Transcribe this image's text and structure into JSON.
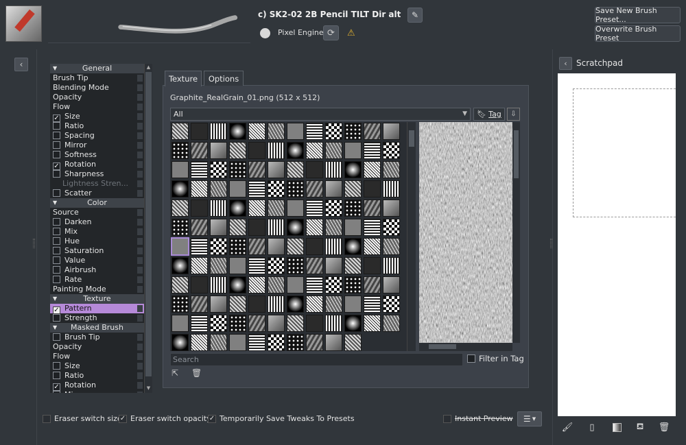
{
  "header": {
    "preset_name": "c) SK2-02 2B Pencil TILT Dir alt",
    "engine_label": "Pixel Engine",
    "save_new_label": "Save New Brush Preset...",
    "overwrite_label": "Overwrite Brush Preset"
  },
  "options_list": [
    {
      "type": "header",
      "label": "General"
    },
    {
      "type": "item",
      "label": "Brush Tip"
    },
    {
      "type": "item",
      "label": "Blending Mode"
    },
    {
      "type": "item",
      "label": "Opacity"
    },
    {
      "type": "item",
      "label": "Flow"
    },
    {
      "type": "check",
      "label": "Size",
      "checked": true
    },
    {
      "type": "check",
      "label": "Ratio",
      "checked": false
    },
    {
      "type": "check",
      "label": "Spacing",
      "checked": false
    },
    {
      "type": "check",
      "label": "Mirror",
      "checked": false
    },
    {
      "type": "check",
      "label": "Softness",
      "checked": false
    },
    {
      "type": "check",
      "label": "Rotation",
      "checked": true
    },
    {
      "type": "check",
      "label": "Sharpness",
      "checked": false
    },
    {
      "type": "disabled",
      "label": "Lightness Stren..."
    },
    {
      "type": "check",
      "label": "Scatter",
      "checked": false
    },
    {
      "type": "header",
      "label": "Color"
    },
    {
      "type": "item",
      "label": "Source"
    },
    {
      "type": "check",
      "label": "Darken",
      "checked": false
    },
    {
      "type": "check",
      "label": "Mix",
      "checked": false
    },
    {
      "type": "check",
      "label": "Hue",
      "checked": false
    },
    {
      "type": "check",
      "label": "Saturation",
      "checked": false
    },
    {
      "type": "check",
      "label": "Value",
      "checked": false
    },
    {
      "type": "check",
      "label": "Airbrush",
      "checked": false
    },
    {
      "type": "check",
      "label": "Rate",
      "checked": false
    },
    {
      "type": "item",
      "label": "Painting Mode"
    },
    {
      "type": "header",
      "label": "Texture"
    },
    {
      "type": "check",
      "label": "Pattern",
      "checked": true,
      "selected": true
    },
    {
      "type": "check",
      "label": "Strength",
      "checked": false
    },
    {
      "type": "header",
      "label": "Masked Brush"
    },
    {
      "type": "check",
      "label": "Brush Tip",
      "checked": false
    },
    {
      "type": "item",
      "label": "Opacity"
    },
    {
      "type": "item",
      "label": "Flow"
    },
    {
      "type": "check",
      "label": "Size",
      "checked": false
    },
    {
      "type": "check",
      "label": "Ratio",
      "checked": false
    },
    {
      "type": "check",
      "label": "Rotation",
      "checked": true
    },
    {
      "type": "check",
      "label": "Mi...",
      "checked": false
    }
  ],
  "texture_panel": {
    "tabs": [
      {
        "label": "Texture"
      },
      {
        "label": "Options"
      }
    ],
    "resource_title": "Graphite_RealGrain_01.png (512 x 512)",
    "tag_filter": "All",
    "tag_button": "Tag",
    "search_placeholder": "Search",
    "filter_in_tag": "Filter in Tag"
  },
  "footer": {
    "eraser_size": {
      "label": "Eraser switch size",
      "checked": false
    },
    "eraser_opacity": {
      "label": "Eraser switch opacity",
      "checked": true
    },
    "save_tweaks": {
      "label": "Temporarily Save Tweaks To Presets",
      "checked": true
    },
    "instant_preview": {
      "label": "Instant Preview",
      "checked": false
    }
  },
  "scratchpad": {
    "title": "Scratchpad"
  },
  "icons": [
    "pencil-edit-icon",
    "reload-icon",
    "warning-icon",
    "chevron-left-icon",
    "bookmark-icon",
    "import-icon",
    "trash-icon",
    "hamburger-menu-icon",
    "brush-icon",
    "page-icon",
    "gradient-icon",
    "fill-bucket-icon"
  ],
  "colors": {
    "selection": "#b589d8",
    "warning": "#e0b030",
    "background": "#31363b"
  }
}
